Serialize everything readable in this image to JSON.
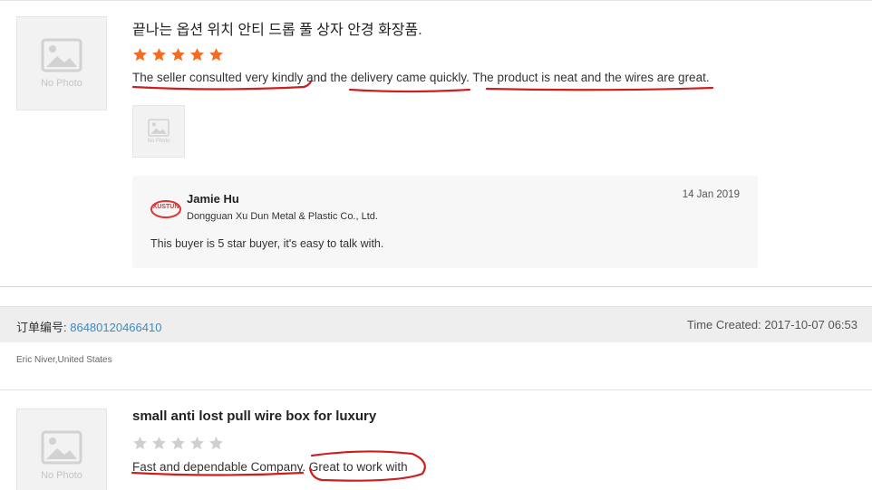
{
  "review1": {
    "no_photo_label": "No Photo",
    "title": "끝나는 옵션 위치 안티 드롭 풀 상자 안경 화장품.",
    "stars_filled": 5,
    "stars_total": 5,
    "star_color": "#f36c21",
    "text": "The seller consulted very kindly and the delivery came quickly. The product is neat and the wires are great.",
    "attachment_label": "No Photo",
    "reply": {
      "logo_text": "XUSTUN",
      "name": "Jamie Hu",
      "company": "Dongguan Xu Dun Metal & Plastic Co., Ltd.",
      "date": "14 Jan 2019",
      "text": "This buyer is 5 star buyer, it's easy to talk with."
    }
  },
  "order": {
    "label": "订单编号: ",
    "number": "86480120466410",
    "number_color": "#3b8bc6",
    "time_created": "Time Created: 2017-10-07 06:53",
    "buyer": "Eric Niver,United States"
  },
  "review2": {
    "no_photo_label": "No Photo",
    "title": "small anti lost pull wire box for luxury",
    "stars_filled": 0,
    "stars_total": 5,
    "star_empty_color": "#cfcfcf",
    "text_part1": "Fast and dependable Company.",
    "text_part2": "Great to work with"
  },
  "annotation_color": "#cc1f1f"
}
